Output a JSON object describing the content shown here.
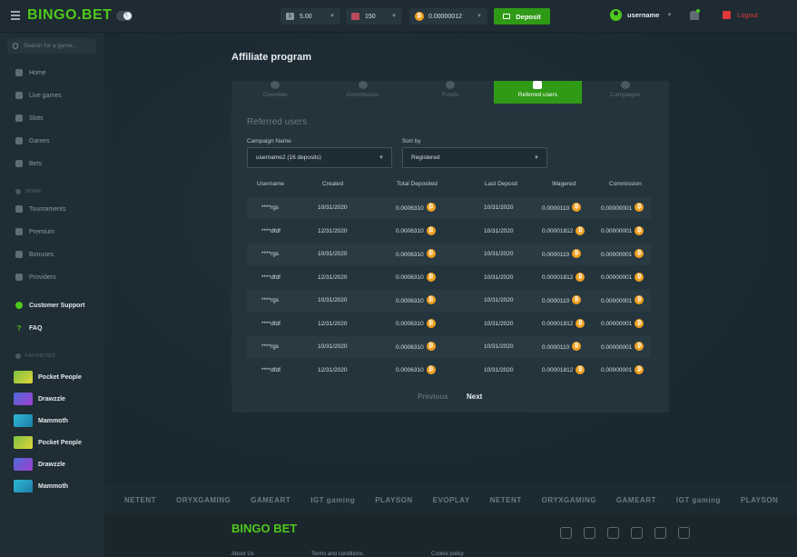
{
  "header": {
    "logo_left": "BING",
    "logo_mid": "O",
    "logo_right": "BET",
    "bet_value": "5.00",
    "flag_value": "150",
    "balance": "0.00000012",
    "deposit_label": "Deposit",
    "username": "username",
    "logout_label": "Logout"
  },
  "sidebar": {
    "search_placeholder": "Search for a game...",
    "nav": [
      "Home",
      "Live games",
      "Slots",
      "Games",
      "Bets"
    ],
    "more_label": "MORE",
    "more_items": [
      "Tournaments",
      "Premium",
      "Bonuses",
      "Providers"
    ],
    "support_label": "Customer Support",
    "faq_label": "FAQ",
    "favorites_label": "FAVORITES",
    "favorites": [
      "Pocket People",
      "Drawzzle",
      "Mammoth",
      "Pocket People",
      "Drawzzle",
      "Mammoth"
    ]
  },
  "main": {
    "title": "Affiliate program",
    "tabs": [
      "Overview",
      "Commission",
      "Funds",
      "Referred users",
      "Campaigns"
    ],
    "active_tab": "Referred users",
    "panel_title": "Referred users",
    "campaign_label": "Campaign Name",
    "campaign_value": "username2 (16 deposits)",
    "sort_label": "Sort by",
    "sort_value": "Registered",
    "columns": [
      "Username",
      "Created",
      "Total Deposited",
      "Last Deposit",
      "Wagered",
      "Commission"
    ],
    "rows": [
      [
        "****rgs",
        "10/31/2020",
        "0.0006310",
        "10/31/2020",
        "0.0000110",
        "0.00000001"
      ],
      [
        "****dfdf",
        "12/31/2020",
        "0.0006310",
        "10/31/2020",
        "0.00001812",
        "0.00000001"
      ],
      [
        "****rgs",
        "10/31/2020",
        "0.0006310",
        "10/31/2020",
        "0.0000110",
        "0.00000001"
      ],
      [
        "****dfdf",
        "12/31/2020",
        "0.0006310",
        "10/31/2020",
        "0.00001812",
        "0.00000001"
      ],
      [
        "****rgs",
        "10/31/2020",
        "0.0006310",
        "10/31/2020",
        "0.0000110",
        "0.00000001"
      ],
      [
        "****dfdf",
        "12/31/2020",
        "0.0006310",
        "10/31/2020",
        "0.00001812",
        "0.00000001"
      ],
      [
        "****rgs",
        "10/31/2020",
        "0.0006310",
        "10/31/2020",
        "0.0000110",
        "0.00000001"
      ],
      [
        "****dfdf",
        "12/31/2020",
        "0.0006310",
        "10/31/2020",
        "0.00001812",
        "0.00000001"
      ]
    ],
    "prev_label": "Previous",
    "next_label": "Next"
  },
  "providers": [
    "NETENT",
    "ORYXGAMING",
    "GAMEART",
    "IGT gaming",
    "PLAYSON",
    "EVOPLAY",
    "NETENT",
    "ORYXGAMING",
    "GAMEART",
    "IGT gaming",
    "PLAYSON",
    "EVOPLAY"
  ],
  "footer": {
    "logo": "BINGO BET",
    "links": [
      "About Us",
      "Terms and conditions",
      "Cookie policy"
    ]
  },
  "colors": {
    "accent": "#2f9a16",
    "logo_green": "#4fc81b",
    "coin": "#f0a020",
    "logout": "#e03a3a"
  }
}
